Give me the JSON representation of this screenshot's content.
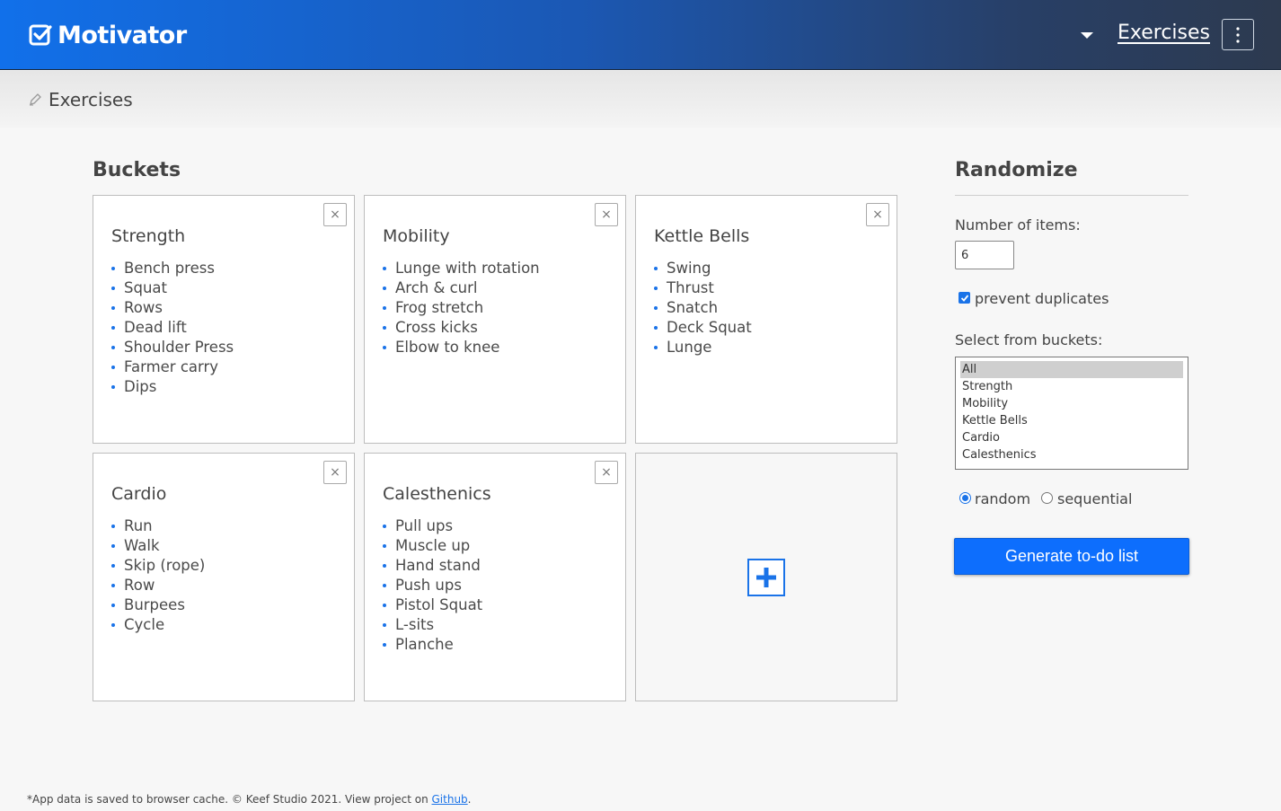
{
  "header": {
    "brand": "Motivator",
    "nav_link": "Exercises"
  },
  "subheader": {
    "title": "Exercises"
  },
  "buckets": {
    "heading": "Buckets",
    "cards": [
      {
        "title": "Strength",
        "items": [
          "Bench press",
          "Squat",
          "Rows",
          "Dead lift",
          "Shoulder Press",
          "Farmer carry",
          "Dips"
        ]
      },
      {
        "title": "Mobility",
        "items": [
          "Lunge with rotation",
          "Arch & curl",
          "Frog stretch",
          "Cross kicks",
          "Elbow to knee"
        ]
      },
      {
        "title": "Kettle Bells",
        "items": [
          "Swing",
          "Thrust",
          "Snatch",
          "Deck Squat",
          "Lunge"
        ]
      },
      {
        "title": "Cardio",
        "items": [
          "Run",
          "Walk",
          "Skip (rope)",
          "Row",
          "Burpees",
          "Cycle"
        ]
      },
      {
        "title": "Calesthenics",
        "items": [
          "Pull ups",
          "Muscle up",
          "Hand stand",
          "Push ups",
          "Pistol Squat",
          "L-sits",
          "Planche"
        ]
      }
    ],
    "close_label": "×"
  },
  "randomize": {
    "heading": "Randomize",
    "number_label": "Number of items:",
    "number_value": "6",
    "prevent_duplicates_label": "prevent duplicates",
    "prevent_duplicates_checked": true,
    "select_label": "Select from buckets:",
    "options": [
      "All",
      "Strength",
      "Mobility",
      "Kettle Bells",
      "Cardio",
      "Calesthenics"
    ],
    "selected_option": "All",
    "mode_random_label": "random",
    "mode_sequential_label": "sequential",
    "mode_selected": "random",
    "generate_label": "Generate to-do list"
  },
  "footer": {
    "text": "*App data is saved to browser cache. © Keef Studio 2021. View project on ",
    "link_label": "Github",
    "suffix": "."
  },
  "colors": {
    "accent": "#1a73e8",
    "button": "#0d6efd",
    "header_start": "#1170ea",
    "header_end": "#2d3a4f"
  }
}
